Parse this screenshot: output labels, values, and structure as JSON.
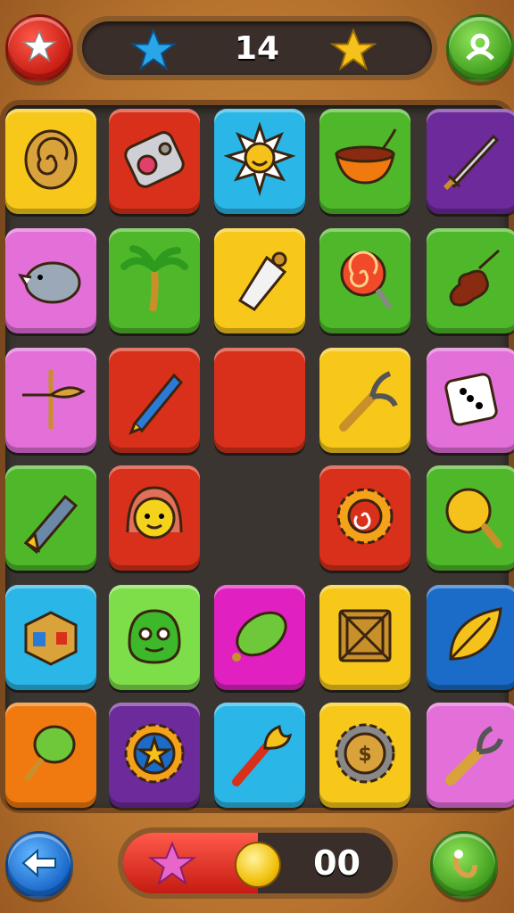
{
  "header": {
    "score": "14",
    "left_button_icon": "star-icon",
    "right_button_icon": "profile-icon",
    "star_left_color": "#2aa5e8",
    "star_right_color": "#f5c21b"
  },
  "footer": {
    "count": "00",
    "progress": 0.5,
    "back_button_icon": "arrow-left-icon",
    "hint_button_icon": "hook-icon",
    "badge_icon": "pink-star-icon"
  },
  "grid": {
    "rows": 6,
    "cols": 5,
    "tiles": [
      {
        "name": "spiral-amulet-icon",
        "color": "#f7c81a"
      },
      {
        "name": "camera-gadget-icon",
        "color": "#d8301a"
      },
      {
        "name": "sun-face-icon",
        "color": "#2ab6e6"
      },
      {
        "name": "bowl-icon",
        "color": "#4fb82a"
      },
      {
        "name": "sword-icon",
        "color": "#6c2a9a"
      },
      {
        "name": "rhino-icon",
        "color": "#e36fd8"
      },
      {
        "name": "palm-tree-icon",
        "color": "#4fb82a"
      },
      {
        "name": "shuttlecock-icon",
        "color": "#f7c81a"
      },
      {
        "name": "lollipop-icon",
        "color": "#4fb82a"
      },
      {
        "name": "violin-icon",
        "color": "#4fb82a"
      },
      {
        "name": "feather-cross-icon",
        "color": "#e36fd8"
      },
      {
        "name": "pen-icon",
        "color": "#d8301a"
      },
      {
        "name": "empty-red-tile",
        "color": "#d8301a"
      },
      {
        "name": "tool-icon",
        "color": "#f7c81a"
      },
      {
        "name": "dice-icon",
        "color": "#e36fd8"
      },
      {
        "name": "marker-icon",
        "color": "#4fb82a"
      },
      {
        "name": "girl-face-icon",
        "color": "#d8301a"
      },
      {
        "name": "empty-slot",
        "color": ""
      },
      {
        "name": "gear-swirl-icon",
        "color": "#d8301a"
      },
      {
        "name": "magnifier-icon",
        "color": "#4fb82a"
      },
      {
        "name": "cube-icon",
        "color": "#2ab6e6"
      },
      {
        "name": "monster-face-icon",
        "color": "#7ede4a"
      },
      {
        "name": "lime-icon",
        "color": "#e020c0"
      },
      {
        "name": "crate-icon",
        "color": "#f7c81a"
      },
      {
        "name": "leaf-icon",
        "color": "#1a6cc8"
      },
      {
        "name": "maraca-icon",
        "color": "#f07a10"
      },
      {
        "name": "gear-star-icon",
        "color": "#6c2a9a"
      },
      {
        "name": "torch-icon",
        "color": "#2ab6e6"
      },
      {
        "name": "coin-gear-icon",
        "color": "#f7c81a"
      },
      {
        "name": "wrench-icon",
        "color": "#e36fd8"
      }
    ]
  }
}
